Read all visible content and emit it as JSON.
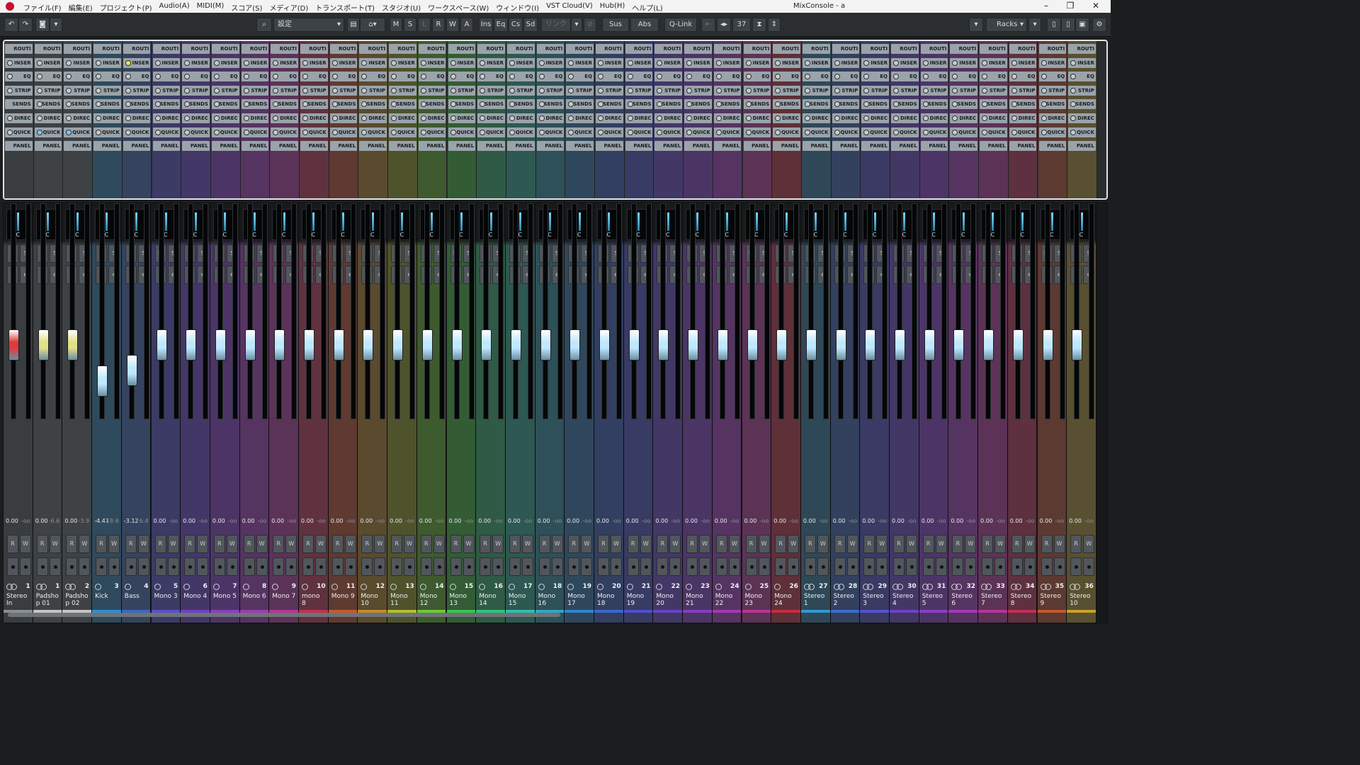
{
  "app": {
    "menus": [
      "ファイル(F)",
      "編集(E)",
      "プロジェクト(P)",
      "Audio(A)",
      "MIDI(M)",
      "スコア(S)",
      "メディア(D)",
      "トランスポート(T)",
      "スタジオ(U)",
      "ワークスペース(W)",
      "ウィンドウ(I)",
      "VST Cloud(V)",
      "Hub(H)",
      "ヘルプ(L)"
    ],
    "window_title": "MixConsole - a",
    "controls": {
      "minimize": "–",
      "maximize": "❐",
      "close": "✕"
    }
  },
  "toolbar": {
    "undo": "↶",
    "redo": "↷",
    "camera": "◙",
    "dropdown": "▾",
    "search": "⌕",
    "config_label": "設定",
    "m": "M",
    "s": "S",
    "l": "L",
    "r": "R",
    "w": "W",
    "a": "A",
    "ins": "Ins",
    "eq": "Eq",
    "cs": "Cs",
    "sd": "Sd",
    "link": "リンク",
    "sus": "Sus",
    "abs": "Abs",
    "qlink": "Q-Link",
    "channel_count": "37",
    "racks": "Racks"
  },
  "rack_labels": [
    "ROUTI",
    "INSER",
    "EQ",
    "STRIP",
    "SENDS",
    "DIREC",
    "QUICK",
    "PANEL"
  ],
  "strip_labels": {
    "pan_center": "C",
    "mute": "M",
    "solo": "S",
    "listen": "L",
    "edit": "e",
    "read": "R",
    "write": "W"
  },
  "channels": [
    {
      "num": "1",
      "name": "Stereo In",
      "val": "0.00",
      "peak": "-oo",
      "color": "#3a3d40",
      "bar": "#8a8f93",
      "cap": "#e03a3a",
      "fader": 0.0,
      "stereo": true
    },
    {
      "num": "1",
      "name": "Padsho p 01",
      "val": "0.00",
      "peak": "-6.6",
      "color": "#3e4245",
      "bar": "#c4c4c4",
      "cap": "#e3e08a",
      "fader": 0.0,
      "stereo": true
    },
    {
      "num": "2",
      "name": "Padsho p 02",
      "val": "0.00",
      "peak": "-3.9",
      "color": "#3e4245",
      "bar": "#c4c4c4",
      "cap": "#e3e08a",
      "fader": 0.0,
      "stereo": true
    },
    {
      "num": "3",
      "name": "Kick",
      "val": "-4.47",
      "peak": "18.6",
      "color": "#2f4a5c",
      "bar": "#2d8fd6",
      "cap": "#bfe8ff",
      "fader": -4.47,
      "stereo": false
    },
    {
      "num": "4",
      "name": "Bass",
      "val": "-3.12",
      "peak": "6.4",
      "color": "#35435e",
      "bar": "#3b68c4",
      "cap": "#bfe8ff",
      "fader": -3.12,
      "stereo": false
    },
    {
      "num": "5",
      "name": "Mono 3",
      "val": "0.00",
      "peak": "-oo",
      "color": "#3b3b66",
      "bar": "#5a4fd0",
      "cap": "#bfe8ff",
      "fader": 0.0,
      "stereo": false
    },
    {
      "num": "6",
      "name": "Mono 4",
      "val": "0.00",
      "peak": "-oo",
      "color": "#433767",
      "bar": "#7040cc",
      "cap": "#bfe8ff",
      "fader": 0.0,
      "stereo": false
    },
    {
      "num": "7",
      "name": "Mono 5",
      "val": "0.00",
      "peak": "-oo",
      "color": "#4c3566",
      "bar": "#8a3cc6",
      "cap": "#bfe8ff",
      "fader": 0.0,
      "stereo": false
    },
    {
      "num": "8",
      "name": "Mono 6",
      "val": "0.00",
      "peak": "-oo",
      "color": "#553462",
      "bar": "#a238b8",
      "cap": "#bfe8ff",
      "fader": 0.0,
      "stereo": false
    },
    {
      "num": "9",
      "name": "Mono 7",
      "val": "0.00",
      "peak": "-oo",
      "color": "#5c3358",
      "bar": "#b8349a",
      "cap": "#bfe8ff",
      "fader": 0.0,
      "stereo": false
    },
    {
      "num": "10",
      "name": "mono 8",
      "val": "0.00",
      "peak": "-oo",
      "color": "#60323f",
      "bar": "#c43050",
      "cap": "#bfe8ff",
      "fader": 0.0,
      "stereo": false
    },
    {
      "num": "11",
      "name": "Mono 9",
      "val": "0.00",
      "peak": "-oo",
      "color": "#5e3a31",
      "bar": "#c85a2c",
      "cap": "#bfe8ff",
      "fader": 0.0,
      "stereo": false
    },
    {
      "num": "12",
      "name": "Mono 10",
      "val": "0.00",
      "peak": "-oo",
      "color": "#5a4a2e",
      "bar": "#c98a28",
      "cap": "#bfe8ff",
      "fader": 0.0,
      "stereo": false
    },
    {
      "num": "13",
      "name": "Mono 11",
      "val": "0.00",
      "peak": "-oo",
      "color": "#4e532c",
      "bar": "#b4c02a",
      "cap": "#bfe8ff",
      "fader": 0.0,
      "stereo": false
    },
    {
      "num": "14",
      "name": "Mono 12",
      "val": "0.00",
      "peak": "-oo",
      "color": "#3e5a2f",
      "bar": "#6ecb30",
      "cap": "#bfe8ff",
      "fader": 0.0,
      "stereo": false
    },
    {
      "num": "15",
      "name": "Mono 13",
      "val": "0.00",
      "peak": "-oo",
      "color": "#335c35",
      "bar": "#34c844",
      "cap": "#bfe8ff",
      "fader": 0.0,
      "stereo": false
    },
    {
      "num": "16",
      "name": "Mono 14",
      "val": "0.00",
      "peak": "-oo",
      "color": "#2f5a45",
      "bar": "#2ec47e",
      "cap": "#bfe8ff",
      "fader": 0.0,
      "stereo": false
    },
    {
      "num": "17",
      "name": "Mono 15",
      "val": "0.00",
      "peak": "-oo",
      "color": "#2e5852",
      "bar": "#2cc0b0",
      "cap": "#bfe8ff",
      "fader": 0.0,
      "stereo": false
    },
    {
      "num": "18",
      "name": "Mono 16",
      "val": "0.00",
      "peak": "-oo",
      "color": "#2e5058",
      "bar": "#2ca8c6",
      "cap": "#bfe8ff",
      "fader": 0.0,
      "stereo": false
    },
    {
      "num": "19",
      "name": "Mono 17",
      "val": "0.00",
      "peak": "-oo",
      "color": "#2f475c",
      "bar": "#2e88d0",
      "cap": "#bfe8ff",
      "fader": 0.0,
      "stereo": false
    },
    {
      "num": "20",
      "name": "Mono 18",
      "val": "0.00",
      "peak": "-oo",
      "color": "#323f60",
      "bar": "#3868d2",
      "cap": "#bfe8ff",
      "fader": 0.0,
      "stereo": false
    },
    {
      "num": "21",
      "name": "Mono 19",
      "val": "0.00",
      "peak": "-oo",
      "color": "#383b64",
      "bar": "#4c50d0",
      "cap": "#bfe8ff",
      "fader": 0.0,
      "stereo": false
    },
    {
      "num": "22",
      "name": "Mono 20",
      "val": "0.00",
      "peak": "-oo",
      "color": "#423866",
      "bar": "#6a42cc",
      "cap": "#bfe8ff",
      "fader": 0.0,
      "stereo": false
    },
    {
      "num": "23",
      "name": "Mono 21",
      "val": "0.00",
      "peak": "-oo",
      "color": "#4b3565",
      "bar": "#883cc6",
      "cap": "#bfe8ff",
      "fader": 0.0,
      "stereo": false
    },
    {
      "num": "24",
      "name": "Mono 22",
      "val": "0.00",
      "peak": "-oo",
      "color": "#553462",
      "bar": "#a438b6",
      "cap": "#bfe8ff",
      "fader": 0.0,
      "stereo": false
    },
    {
      "num": "25",
      "name": "Mono 23",
      "val": "0.00",
      "peak": "-oo",
      "color": "#5c3355",
      "bar": "#bb3494",
      "cap": "#bfe8ff",
      "fader": 0.0,
      "stereo": false
    },
    {
      "num": "26",
      "name": "Mono 24",
      "val": "0.00",
      "peak": "-oo",
      "color": "#5e3038",
      "bar": "#c82c3c",
      "cap": "#bfe8ff",
      "fader": 0.0,
      "stereo": false
    },
    {
      "num": "27",
      "name": "Stereo 1",
      "val": "0.00",
      "peak": "-oo",
      "color": "#2f4858",
      "bar": "#2d9cd4",
      "cap": "#bfe8ff",
      "fader": 0.0,
      "stereo": true
    },
    {
      "num": "28",
      "name": "Stereo 2",
      "val": "0.00",
      "peak": "-oo",
      "color": "#33405e",
      "bar": "#3a6ed0",
      "cap": "#bfe8ff",
      "fader": 0.0,
      "stereo": true
    },
    {
      "num": "29",
      "name": "Stereo 3",
      "val": "0.00",
      "peak": "-oo",
      "color": "#3a3a64",
      "bar": "#5652d0",
      "cap": "#bfe8ff",
      "fader": 0.0,
      "stereo": true
    },
    {
      "num": "30",
      "name": "Stereo 4",
      "val": "0.00",
      "peak": "-oo",
      "color": "#433766",
      "bar": "#7040cc",
      "cap": "#bfe8ff",
      "fader": 0.0,
      "stereo": true
    },
    {
      "num": "31",
      "name": "Stereo 5",
      "val": "0.00",
      "peak": "-oo",
      "color": "#4c3566",
      "bar": "#8c3cc6",
      "cap": "#bfe8ff",
      "fader": 0.0,
      "stereo": true
    },
    {
      "num": "32",
      "name": "Stereo 6",
      "val": "0.00",
      "peak": "-oo",
      "color": "#563462",
      "bar": "#a638b6",
      "cap": "#bfe8ff",
      "fader": 0.0,
      "stereo": true
    },
    {
      "num": "33",
      "name": "Stereo 7",
      "val": "0.00",
      "peak": "-oo",
      "color": "#5c3356",
      "bar": "#ba3498",
      "cap": "#bfe8ff",
      "fader": 0.0,
      "stereo": true
    },
    {
      "num": "34",
      "name": "Stereo 8",
      "val": "0.00",
      "peak": "-oo",
      "color": "#5e3040",
      "bar": "#c42e54",
      "cap": "#bfe8ff",
      "fader": 0.0,
      "stereo": true
    },
    {
      "num": "35",
      "name": "Stereo 9",
      "val": "0.00",
      "peak": "-oo",
      "color": "#5c3a32",
      "bar": "#c8582e",
      "cap": "#bfe8ff",
      "fader": 0.0,
      "stereo": true
    },
    {
      "num": "36",
      "name": "Stereo 10",
      "val": "0.00",
      "peak": "-oo",
      "color": "#585030",
      "bar": "#c9a22a",
      "cap": "#bfe8ff",
      "fader": 0.0,
      "stereo": true
    }
  ]
}
